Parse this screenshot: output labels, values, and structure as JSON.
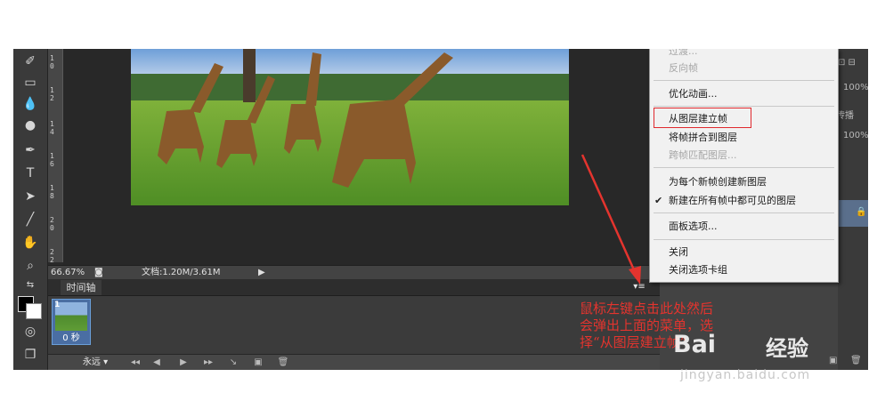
{
  "status_bar": {
    "zoom": "66.67%",
    "doc_info": "文档:1.20M/3.61M"
  },
  "timeline": {
    "tab_label": "时间轴",
    "frame": {
      "number": "1",
      "delay": "0 秒"
    },
    "loop_option": "永远"
  },
  "ruler_marks": [
    "1 0",
    "1 2",
    "1 4",
    "1 6",
    "1 8",
    "2 0",
    "2 2"
  ],
  "flyout_menu": {
    "items": [
      {
        "label": "过渡...",
        "disabled": true
      },
      {
        "label": "反向帧",
        "disabled": true
      },
      {
        "label": "优化动画...",
        "disabled": false
      },
      {
        "label": "从图层建立帧",
        "disabled": false,
        "highlighted": true
      },
      {
        "label": "将帧拼合到图层",
        "disabled": false
      },
      {
        "label": "跨帧匹配图层...",
        "disabled": true
      },
      {
        "label": "为每个新帧创建新图层",
        "disabled": false
      },
      {
        "label": "新建在所有帧中都可见的图层",
        "disabled": false,
        "checked": true
      },
      {
        "label": "面板选项...",
        "disabled": false
      },
      {
        "label": "关闭",
        "disabled": false
      },
      {
        "label": "关闭选项卡组",
        "disabled": false
      }
    ]
  },
  "right_panel": {
    "opacity": "100%",
    "fill": "100%",
    "propagate_label": "传播",
    "fill2": "100%"
  },
  "annotation": {
    "line1": "鼠标左键点击此处然后",
    "line2": "会弹出上面的菜单，选",
    "line3": "择“从图层建立帧”"
  },
  "watermark": {
    "brand": "Bai",
    "name": "经验",
    "url": "jingyan.baidu.com"
  },
  "colors": {
    "highlight_border": "#e0292e",
    "annotation_text": "#e4342e"
  }
}
